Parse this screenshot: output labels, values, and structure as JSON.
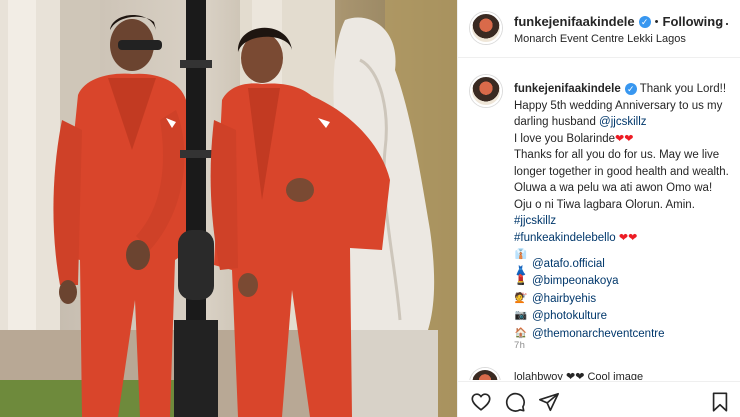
{
  "header": {
    "username": "funkejenifaakindele",
    "follow_status": "Following",
    "location": "Monarch Event Centre Lekki Lagos",
    "separator": "•",
    "more_label": "···"
  },
  "caption": {
    "username": "funkejenifaakindele",
    "line1": " Thank you Lord!! Happy 5th wedding Anniversary to us my darling husband ",
    "mention_husband": "@jjcskillz",
    "line2": "I love you Bolarinde",
    "line3": "Thanks for all you do for us. May we live longer together in good health and wealth. Oluwa a wa pelu wa ati awon Omo wa! Oju o ni Tiwa lagbara Olorun. Amin. ",
    "hashtag1": "#jjcskillz",
    "hashtag2": "#funkeakindelebello",
    "hearts": "❤❤",
    "credits": [
      {
        "emoji": "👔👗",
        "handle": "@atafo.official"
      },
      {
        "emoji": "💄",
        "handle": "@bimpeonakoya"
      },
      {
        "emoji": "💇",
        "handle": "@hairbyehis"
      },
      {
        "emoji": "📷",
        "handle": "@photokulture"
      },
      {
        "emoji": "🏠",
        "handle": "@themonarcheventcentre"
      }
    ],
    "timestamp": "7h"
  },
  "comment_peek": {
    "text": "lolahbwoy ❤❤ Cool image"
  },
  "actions": {
    "like": "heart-outline-icon",
    "comment": "comment-icon",
    "share": "paper-plane-icon",
    "save": "bookmark-icon"
  },
  "colors": {
    "suit": "#d9452b",
    "verified": "#3897f0",
    "link": "#00376b",
    "muted": "#8e8e8e"
  }
}
